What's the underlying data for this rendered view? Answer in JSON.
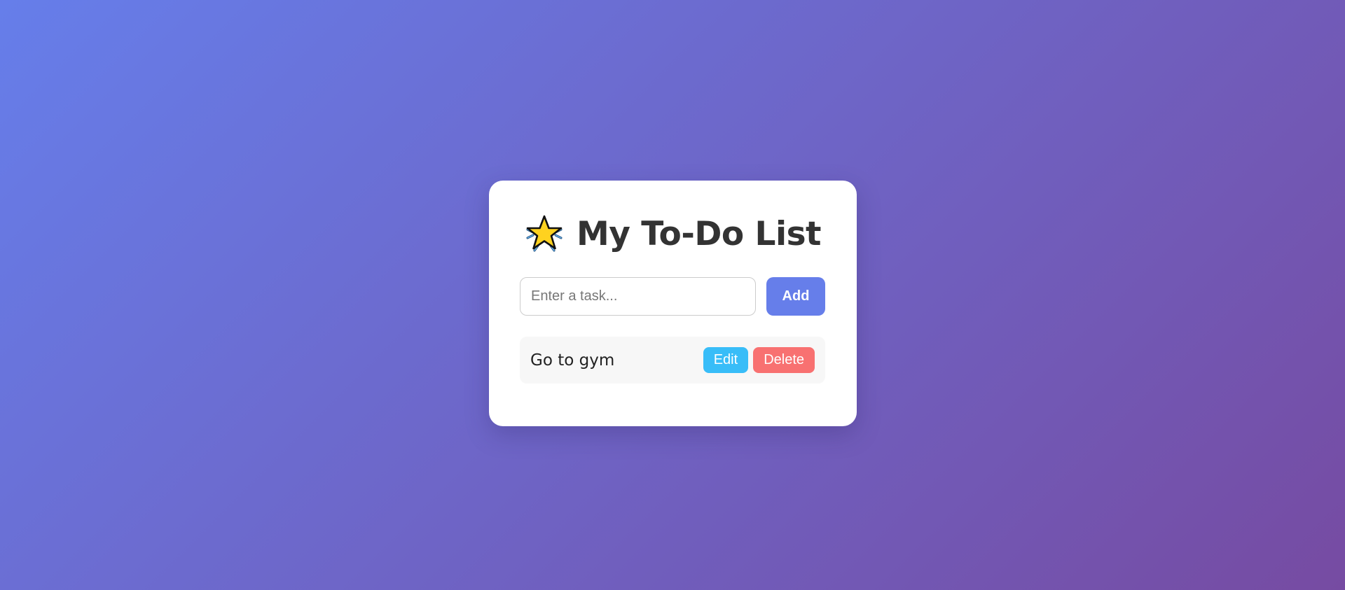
{
  "app": {
    "title": "My To-Do List",
    "title_icon": "sparkle-star-icon"
  },
  "input": {
    "placeholder": "Enter a task...",
    "value": ""
  },
  "add_button": {
    "label": "Add"
  },
  "tasks": [
    {
      "text": "Go to gym",
      "edit_label": "Edit",
      "delete_label": "Delete"
    }
  ],
  "colors": {
    "background_gradient_start": "#667eea",
    "background_gradient_end": "#764ba2",
    "add_button": "#667eea",
    "edit_button": "#38bdf8",
    "delete_button": "#f87171"
  }
}
